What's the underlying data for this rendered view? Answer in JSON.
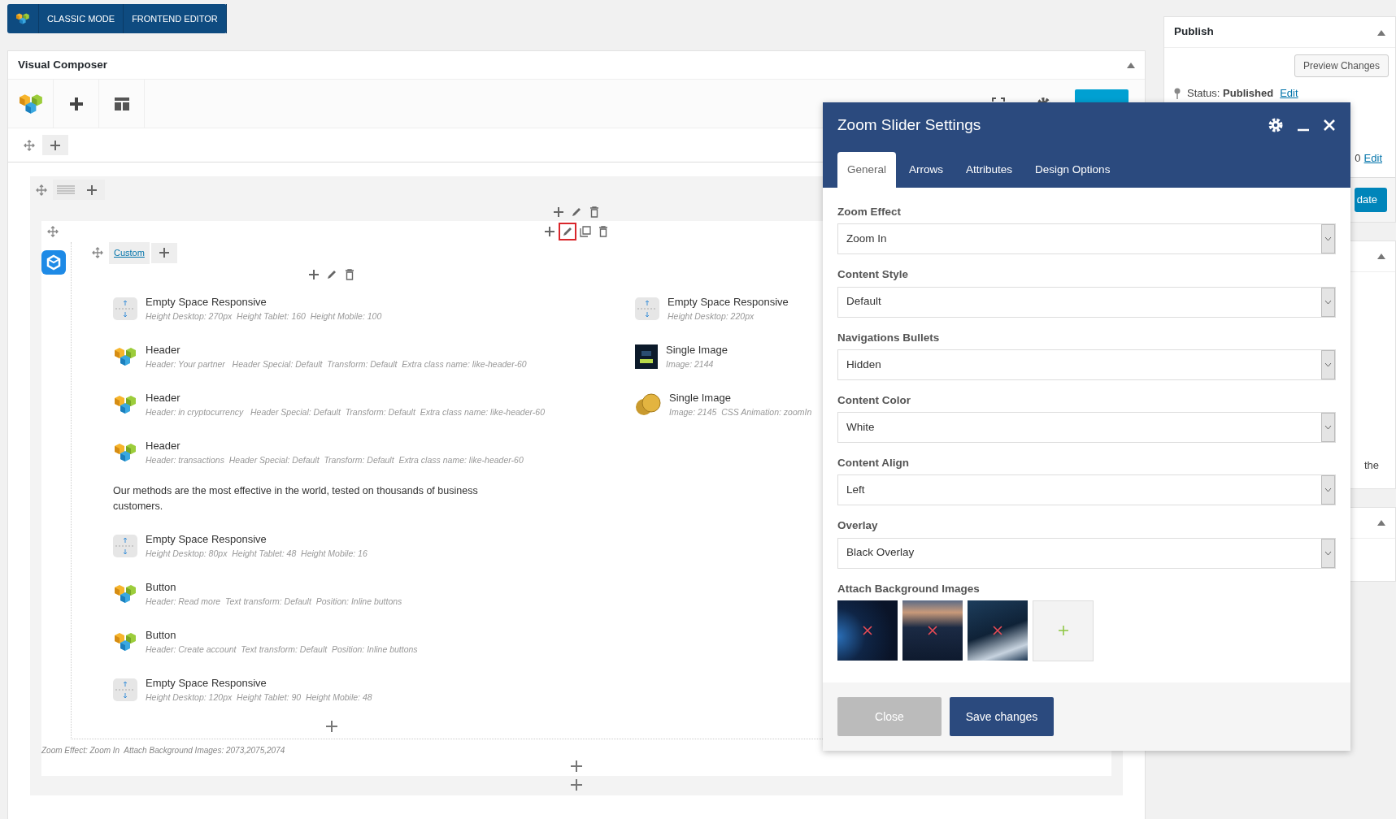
{
  "mode_bar": {
    "buttons": [
      "CLASSIC MODE",
      "FRONTEND EDITOR"
    ]
  },
  "composer": {
    "title": "Visual Composer",
    "row_controls": [
      {
        "kind": "add",
        "highlighted": false
      },
      {
        "kind": "edit",
        "highlighted": false
      },
      {
        "kind": "delete",
        "highlighted": false
      }
    ],
    "inner_controls": [
      {
        "kind": "add",
        "highlighted": false
      },
      {
        "kind": "edit",
        "highlighted": true
      },
      {
        "kind": "clone",
        "highlighted": false
      },
      {
        "kind": "delete",
        "highlighted": false
      }
    ],
    "column_tab": "Custom",
    "left_elements": [
      {
        "kind": "spacer",
        "title": "Empty Space Responsive",
        "details": "Height Desktop: 270px  Height Tablet: 160  Height Mobile: 100"
      },
      {
        "kind": "vc",
        "title": "Header",
        "details": "Header: Your partner   Header Special: Default  Transform: Default  Extra class name: like-header-60"
      },
      {
        "kind": "vc",
        "title": "Header",
        "details": "Header: in cryptocurrency   Header Special: Default  Transform: Default  Extra class name: like-header-60"
      },
      {
        "kind": "vc",
        "title": "Header",
        "details": "Header: transactions  Header Special: Default  Transform: Default  Extra class name: like-header-60"
      },
      {
        "kind": "text",
        "text": "Our methods are the most effective in the world, tested on thousands of business customers."
      },
      {
        "kind": "spacer",
        "title": "Empty Space Responsive",
        "details": "Height Desktop: 80px  Height Tablet: 48  Height Mobile: 16"
      },
      {
        "kind": "vc",
        "title": "Button",
        "details": "Header: Read more  Text transform: Default  Position: Inline buttons"
      },
      {
        "kind": "vc",
        "title": "Button",
        "details": "Header: Create account  Text transform: Default  Position: Inline buttons"
      },
      {
        "kind": "spacer",
        "title": "Empty Space Responsive",
        "details": "Height Desktop: 120px  Height Tablet: 90  Height Mobile: 48"
      }
    ],
    "right_elements": [
      {
        "kind": "spacer",
        "title": "Empty Space Responsive",
        "details": "Height Desktop: 220px"
      },
      {
        "kind": "poster",
        "title": "Single Image",
        "details": "Image: 2144"
      },
      {
        "kind": "coins",
        "title": "Single Image",
        "details": "Image: 2145  CSS Animation: zoomIn"
      }
    ],
    "summary": "Zoom Effect: Zoom In  Attach Background Images: 2073,2075,2074"
  },
  "publish": {
    "title": "Publish",
    "preview_button": "Preview Changes",
    "status_label": "Status:",
    "status_value": "Published",
    "status_link": "Edit",
    "date_fragment": "0",
    "date_link": "Edit",
    "update_button": "date"
  },
  "sidebar_fragment": "the",
  "modal": {
    "title": "Zoom Slider Settings",
    "tabs": [
      {
        "label": "General",
        "selected": true
      },
      {
        "label": "Arrows",
        "selected": false
      },
      {
        "label": "Attributes",
        "selected": false
      },
      {
        "label": "Design Options",
        "selected": false
      }
    ],
    "fields": [
      {
        "label": "Zoom Effect",
        "value": "Zoom In"
      },
      {
        "label": "Content Style",
        "value": "Default"
      },
      {
        "label": "Navigations Bullets",
        "value": "Hidden"
      },
      {
        "label": "Content Color",
        "value": "White"
      },
      {
        "label": "Content Align",
        "value": "Left"
      },
      {
        "label": "Overlay",
        "value": "Black Overlay"
      }
    ],
    "images_label": "Attach Background Images",
    "images": [
      {
        "kind": "earth"
      },
      {
        "kind": "city"
      },
      {
        "kind": "network"
      }
    ],
    "close_button": "Close",
    "save_button": "Save changes"
  }
}
